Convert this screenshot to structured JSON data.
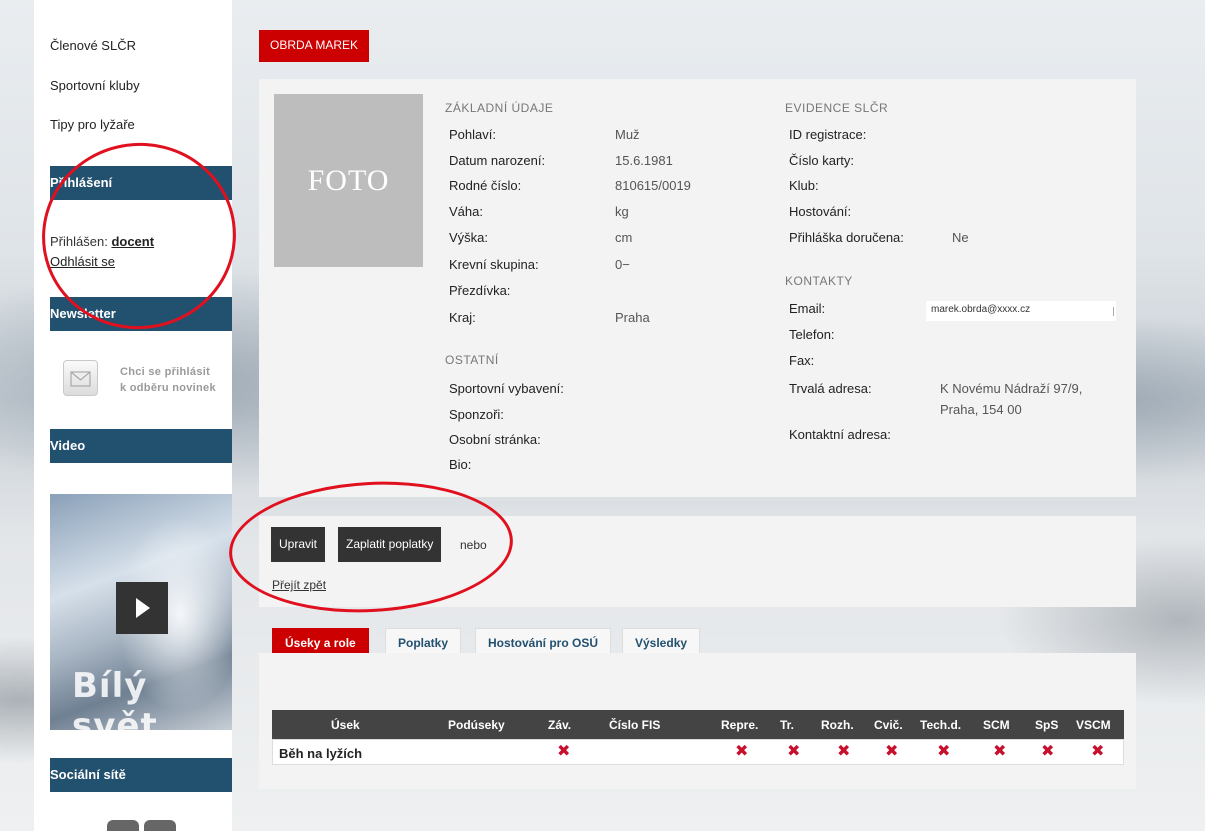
{
  "sidebar": {
    "links": [
      "Členové SLČR",
      "Sportovní kluby",
      "Tipy pro lyžaře"
    ],
    "login_heading": "Přihlášení",
    "logged_in_prefix": "Přihlášen:",
    "logged_in_user": "docent",
    "logout_label": "Odhlásit se",
    "newsletter_heading": "Newsletter",
    "newsletter_line1": "Chci se přihlásit",
    "newsletter_line2": "k odběru novinek",
    "video_heading": "Video",
    "video_title": "Bílý svět",
    "social_heading": "Sociální sítě"
  },
  "profile": {
    "name": "OBRDA MAREK",
    "photo_placeholder": "FOTO",
    "basic": {
      "title": "ZÁKLADNÍ ÚDAJE",
      "rows": [
        {
          "label": "Pohlaví:",
          "value": "Muž"
        },
        {
          "label": "Datum narození:",
          "value": "15.6.1981"
        },
        {
          "label": "Rodné číslo:",
          "value": "810615/0019"
        },
        {
          "label": "Váha:",
          "value": "kg"
        },
        {
          "label": "Výška:",
          "value": "cm"
        },
        {
          "label": "Krevní skupina:",
          "value": "0−"
        },
        {
          "label": "Přezdívka:",
          "value": ""
        },
        {
          "label": "Kraj:",
          "value": "Praha"
        }
      ]
    },
    "other": {
      "title": "OSTATNÍ",
      "rows": [
        "Sportovní vybavení:",
        "Sponzoři:",
        "Osobní stránka:",
        "Bio:"
      ]
    },
    "registry": {
      "title": "EVIDENCE SLČR",
      "rows": [
        {
          "label": "ID registrace:",
          "value": ""
        },
        {
          "label": "Číslo karty:",
          "value": ""
        },
        {
          "label": "Klub:",
          "value": ""
        },
        {
          "label": "Hostování:",
          "value": ""
        },
        {
          "label": "Přihláška doručena:",
          "value": "Ne"
        }
      ]
    },
    "contacts": {
      "title": "KONTAKTY",
      "email_label": "Email:",
      "email_value": "marek.obrda@xxxx.cz",
      "phone_label": "Telefon:",
      "fax_label": "Fax:",
      "address_label": "Trvalá adresa:",
      "address_line1": "K Novému Nádraží 97/9,",
      "address_line2": "Praha, 154 00",
      "contact_address_label": "Kontaktní adresa:"
    }
  },
  "actions": {
    "edit": "Upravit",
    "pay": "Zaplatit poplatky",
    "or": "nebo",
    "back": "Přejít zpět"
  },
  "tabs": [
    "Úseky a role",
    "Poplatky",
    "Hostování pro OSÚ",
    "Výsledky"
  ],
  "table": {
    "headers": [
      "Úsek",
      "Podúseky",
      "Záv.",
      "Číslo FIS",
      "Repre.",
      "Tr.",
      "Rozh.",
      "Cvič.",
      "Tech.d.",
      "SCM",
      "SpS",
      "VSCM"
    ],
    "row_name": "Běh na lyžích",
    "mark_symbol": "✖"
  },
  "colors": {
    "accent_red": "#cc0000",
    "sidebar_header": "#22506f",
    "table_header": "#444444",
    "annotation_circle": "#e0101f"
  }
}
